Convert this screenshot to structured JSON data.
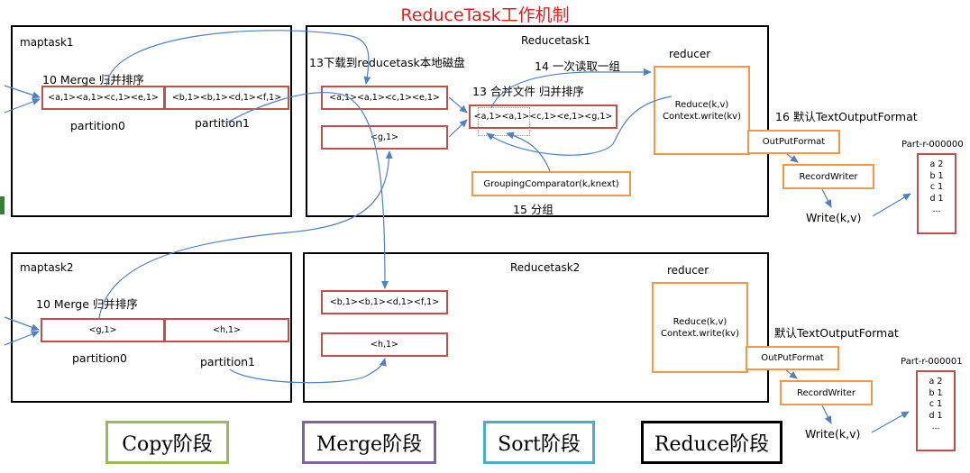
{
  "title": "ReduceTask工作机制",
  "maptask1": {
    "label": "maptask1",
    "merge_label": "10 Merge 归并排序",
    "partition0_content": "<a,1><a,1><c,1><e,1>",
    "partition1_content": "<b,1><b,1><d,1><f,1>",
    "partition0_label": "partition0",
    "partition1_label": "partition1"
  },
  "maptask2": {
    "label": "maptask2",
    "merge_label": "10 Merge 归并排序",
    "partition0_content": "<g,1>",
    "partition1_content": "<h,1>",
    "partition0_label": "partition0",
    "partition1_label": "partition1"
  },
  "reducetask1": {
    "label": "Reducetask1",
    "download_label": "13下载到reducetask本地磁盘",
    "read_label": "14 一次读取一组",
    "merge_label": "13 合并文件 归并排序",
    "box1": "<a,1><a,1><c,1><e,1>",
    "box2": "<g,1>",
    "merged": "<a,1><a,1><c,1><e,1><g,1>",
    "grouping": "GroupingComparator(k,knext)",
    "group_label": "15 分组",
    "reducer_label": "reducer",
    "reduce_line1": "Reduce(k,v)",
    "reduce_line2": "Context.write(kv)",
    "format_label": "16 默认TextOutputFormat",
    "outputformat": "OutPutFormat",
    "recordwriter": "RecordWriter",
    "write": "Write(k,v)",
    "file_name": "Part-r-000000",
    "file_lines": [
      "a 2",
      "b 1",
      "c 1",
      "d 1",
      "..."
    ]
  },
  "reducetask2": {
    "label": "Reducetask2",
    "box1": "<b,1><b,1><d,1><f,1>",
    "box2": "<h,1>",
    "reducer_label": "reducer",
    "reduce_line1": "Reduce(k,v)",
    "reduce_line2": "Context.write(kv)",
    "format_label": "默认TextOutputFormat",
    "outputformat": "OutPutFormat",
    "recordwriter": "RecordWriter",
    "write": "Write(k,v)",
    "file_name": "Part-r-000001",
    "file_lines": [
      "a 2",
      "b 1",
      "c 1",
      "d 1",
      "..."
    ]
  },
  "phases": {
    "copy": "Copy阶段",
    "merge": "Merge阶段",
    "sort": "Sort阶段",
    "reduce": "Reduce阶段"
  },
  "colors": {
    "title": "#e41e1e",
    "partition_border": "#c0504d",
    "reducer_border": "#f79646",
    "arrow": "#4f81bd",
    "copy_phase": "#9bbb59",
    "merge_phase": "#8064a2",
    "sort_phase": "#4bacc6",
    "reduce_phase": "#000000"
  }
}
